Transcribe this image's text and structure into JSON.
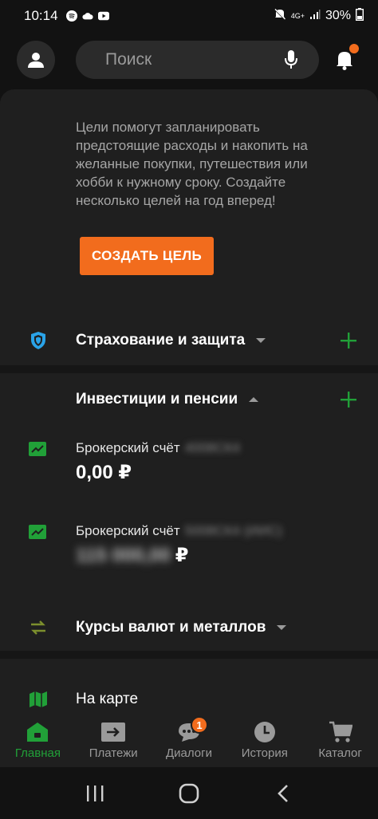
{
  "status_bar": {
    "time": "10:14",
    "battery": "30%",
    "network": "4G+",
    "icons": [
      "spotify-icon",
      "cloud-icon",
      "youtube-icon",
      "mute-icon",
      "signal-icon",
      "battery-icon"
    ]
  },
  "header": {
    "search_placeholder": "Поиск",
    "has_notification": true
  },
  "goals": {
    "description": "Цели помогут запланировать предстоящие расходы и накопить на желанные покупки, путешествия или хобби к нужному сроку. Создайте несколько целей на год вперед!",
    "create_button": "СОЗДАТЬ ЦЕЛЬ"
  },
  "sections": {
    "insurance": {
      "title": "Страхование и защита",
      "expanded": false
    },
    "investments": {
      "title": "Инвестиции и пенсии",
      "expanded": true
    },
    "currency": {
      "title": "Курсы валют и металлов",
      "expanded": false
    },
    "map": {
      "title": "На карте"
    }
  },
  "accounts": [
    {
      "name": "Брокерский счёт",
      "masked_id": "4008СК4",
      "balance": "0,00 ₽"
    },
    {
      "name": "Брокерский счёт",
      "masked_id": "5008СК4 (ИИС)",
      "masked_balance": "115 000,00",
      "currency": "₽"
    }
  ],
  "bottom_nav": [
    {
      "label": "Главная",
      "icon": "home-icon",
      "active": true
    },
    {
      "label": "Платежи",
      "icon": "payments-icon",
      "active": false
    },
    {
      "label": "Диалоги",
      "icon": "chat-icon",
      "active": false,
      "badge": "1"
    },
    {
      "label": "История",
      "icon": "clock-icon",
      "active": false
    },
    {
      "label": "Каталог",
      "icon": "cart-icon",
      "active": false
    }
  ],
  "colors": {
    "accent_orange": "#f26c1d",
    "accent_green": "#21a038",
    "shield_blue": "#2aa3e8",
    "currency_olive": "#7c8f2d"
  }
}
